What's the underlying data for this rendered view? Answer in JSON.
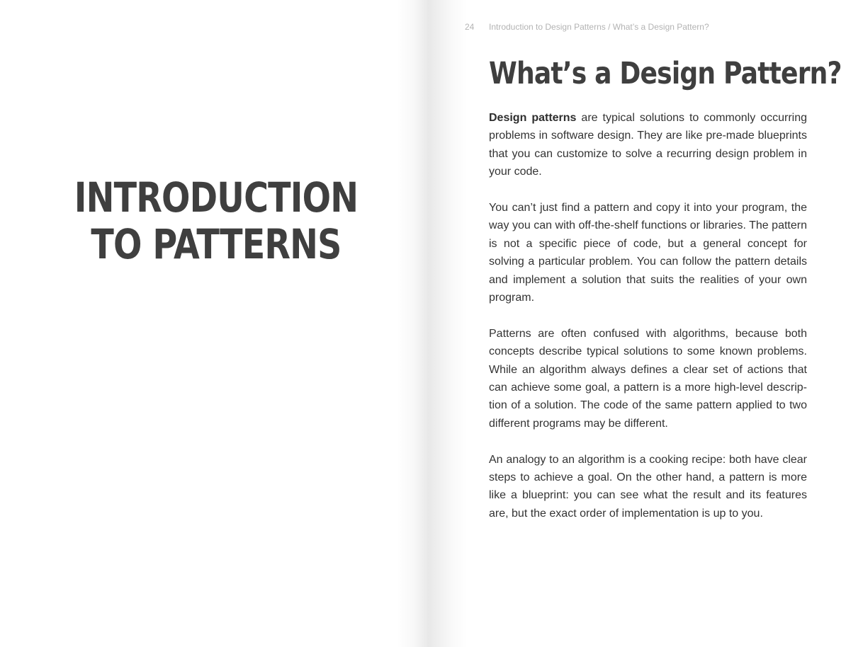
{
  "left_page": {
    "chapter_title_line1": "INTRODUCTION",
    "chapter_title_line2": "TO PATTERNS"
  },
  "right_page": {
    "page_number": "24",
    "running_header": "Introduction to Design Patterns / What’s a Design Pattern?",
    "section_title": "What’s a Design Pattern?",
    "paragraphs": [
      {
        "bold_lead": "Design patterns",
        "text": " are typical solutions to commonly occurring problems in software design. They are like pre-made blue­prints that you can customize to solve a recurring design prob­lem in your code."
      },
      {
        "text": "You can’t just find a pattern and copy it into your program, the way you can with off-the-shelf functions or libraries. The pattern is not a specific piece of code, but a general concept for solving a particular problem. You can follow the pattern details and implement a solution that suits the realities of your own program."
      },
      {
        "text": "Patterns are often confused with algorithms, because both concepts describe typical solutions to some known problems. While an algorithm always defines a clear set of actions that can achieve some goal, a pattern is a more high-level descrip­tion of a solution. The code of the same pattern applied to two different programs may be different."
      },
      {
        "text": "An analogy to an algorithm is a cooking recipe: both have clear steps to achieve a goal. On the other hand, a pattern is more like a blueprint: you can see what the result and its features are, but the exact order of implementation is up to you."
      }
    ]
  }
}
